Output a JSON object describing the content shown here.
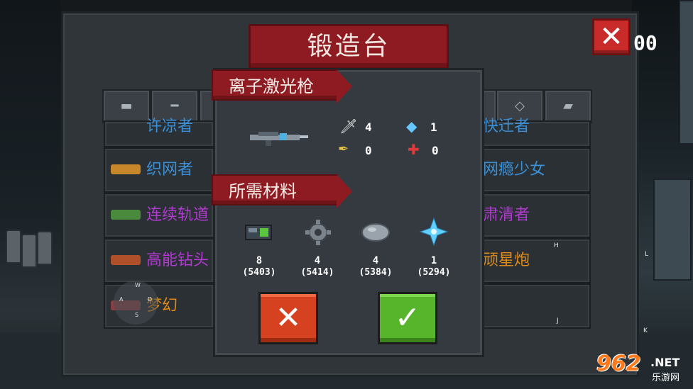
{
  "screen": {
    "title": "锻造台",
    "score": "00"
  },
  "tabs": [
    "pistol-icon",
    "rifle-icon",
    "shotgun-icon",
    "",
    "",
    "",
    "",
    "",
    "",
    "",
    "smg-icon",
    "target-icon",
    "shark-gun-icon"
  ],
  "weapons_left": [
    {
      "name": "许凉者",
      "color": "#3b8fd6",
      "icon": "blue-gun-icon"
    },
    {
      "name": "织网者",
      "color": "#3b8fd6",
      "icon": "gold-gun-icon"
    },
    {
      "name": "连续轨道",
      "color": "#b13ad1",
      "icon": "green-gun-icon"
    },
    {
      "name": "高能钻头",
      "color": "#b13ad1",
      "icon": "drill-icon"
    },
    {
      "name": "梦幻",
      "color": "#e08a1a",
      "icon": "dream-gun-icon"
    }
  ],
  "weapons_right": [
    {
      "name": "快迁者",
      "color": "#3b8fd6"
    },
    {
      "name": "网瘾少女",
      "color": "#3b8fd6"
    },
    {
      "name": "肃清者",
      "color": "#b13ad1"
    },
    {
      "name": "顽星炮",
      "color": "#e08a1a"
    }
  ],
  "dialog": {
    "weapon_name": "离子激光枪",
    "stats": {
      "damage": "4",
      "energy": "1",
      "crit": "0",
      "spread": "0"
    },
    "materials_title": "所需材料",
    "materials": [
      {
        "icon": "battery-icon",
        "count": "8",
        "owned": "(5403)"
      },
      {
        "icon": "gear-icon",
        "count": "4",
        "owned": "(5414)"
      },
      {
        "icon": "ore-icon",
        "count": "4",
        "owned": "(5384)"
      },
      {
        "icon": "crystal-icon",
        "count": "1",
        "owned": "(5294)"
      }
    ],
    "cancel_label": "✕",
    "confirm_label": "✓"
  },
  "joystick": {
    "w": "W",
    "a": "A",
    "s": "S",
    "d": "D"
  },
  "key_hints": {
    "h": "H",
    "l": "L",
    "j": "J",
    "k": "K"
  },
  "watermark": {
    "num": "962",
    "net": ".NET",
    "sub": "乐游网"
  },
  "colors": {
    "accent_red": "#8e1b22",
    "confirm_green": "#56b52b",
    "cancel_red": "#d6411f"
  }
}
